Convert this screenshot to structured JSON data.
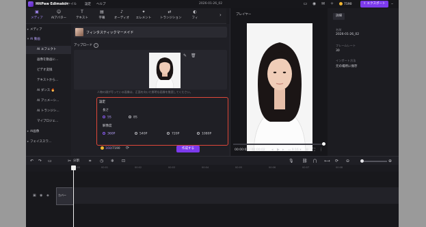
{
  "app": {
    "title": "HitPaw Edimakor",
    "menu": [
      "ファイル",
      "設定",
      "ヘルプ"
    ],
    "document_date": "2026-01-26_02",
    "credits": "7190",
    "export_label": "エクスポート"
  },
  "toolbar": {
    "tools": [
      {
        "label": "メディア",
        "icon": "▣"
      },
      {
        "label": "AIアバター",
        "icon": "☺"
      },
      {
        "label": "テキスト",
        "icon": "T"
      },
      {
        "label": "字幕",
        "icon": "▤"
      },
      {
        "label": "オーディオ",
        "icon": "♪"
      },
      {
        "label": "エレメント",
        "icon": "✦"
      },
      {
        "label": "トランジション",
        "icon": "⇄"
      },
      {
        "label": "フィ",
        "icon": "◐"
      }
    ]
  },
  "sidebar": {
    "items": [
      {
        "label": "メディア",
        "chev": "▸"
      },
      {
        "label": "AI 動画",
        "chev": "▾"
      },
      {
        "label": "AI エフェクト"
      },
      {
        "label": "画像を動画に..."
      },
      {
        "label": "ビデオ変換"
      },
      {
        "label": "テキストから..."
      },
      {
        "label": "AI ダンス"
      },
      {
        "label": "AI アニメーシ..."
      },
      {
        "label": "AI トランジシ..."
      },
      {
        "label": "マイプロジェ..."
      },
      {
        "label": "AI画像",
        "chev": "▸"
      },
      {
        "label": "フェイススワ...",
        "chev": "▸"
      }
    ]
  },
  "panel": {
    "model_name": "フィンタスティックマーメイド",
    "upload_label": "アップロード",
    "hint": "人物の顔が写っている画像は、正面を向いた鮮明な画像を推奨してください。",
    "settings_title": "設定",
    "length_label": "長さ",
    "length_options": [
      "5S",
      "8S"
    ],
    "length_selected": "5S",
    "resolution_label": "解像度",
    "resolution_options": [
      "360P",
      "540P",
      "720P",
      "1080P"
    ],
    "resolution_selected": "360P",
    "credit_used": "160",
    "credit_total": "/7190",
    "create_label": "作成する"
  },
  "preview": {
    "title": "プレイヤー",
    "time": "00:00:02 / 00:00:02",
    "ratio": "9:16"
  },
  "details": {
    "tab": "詳細",
    "fields": [
      {
        "key": "名前",
        "value": "2026-01-26_02"
      },
      {
        "key": "フレームレート",
        "value": "30"
      },
      {
        "key": "インポート方法",
        "value": "元の場所に保存"
      }
    ]
  },
  "timeline": {
    "split_label": "分割",
    "ticks": [
      "00:00",
      "00:01",
      "00:02",
      "00:03",
      "00:04",
      "00:05",
      "00:06",
      "00:07",
      "00:08"
    ],
    "clip_label": "カバー"
  }
}
